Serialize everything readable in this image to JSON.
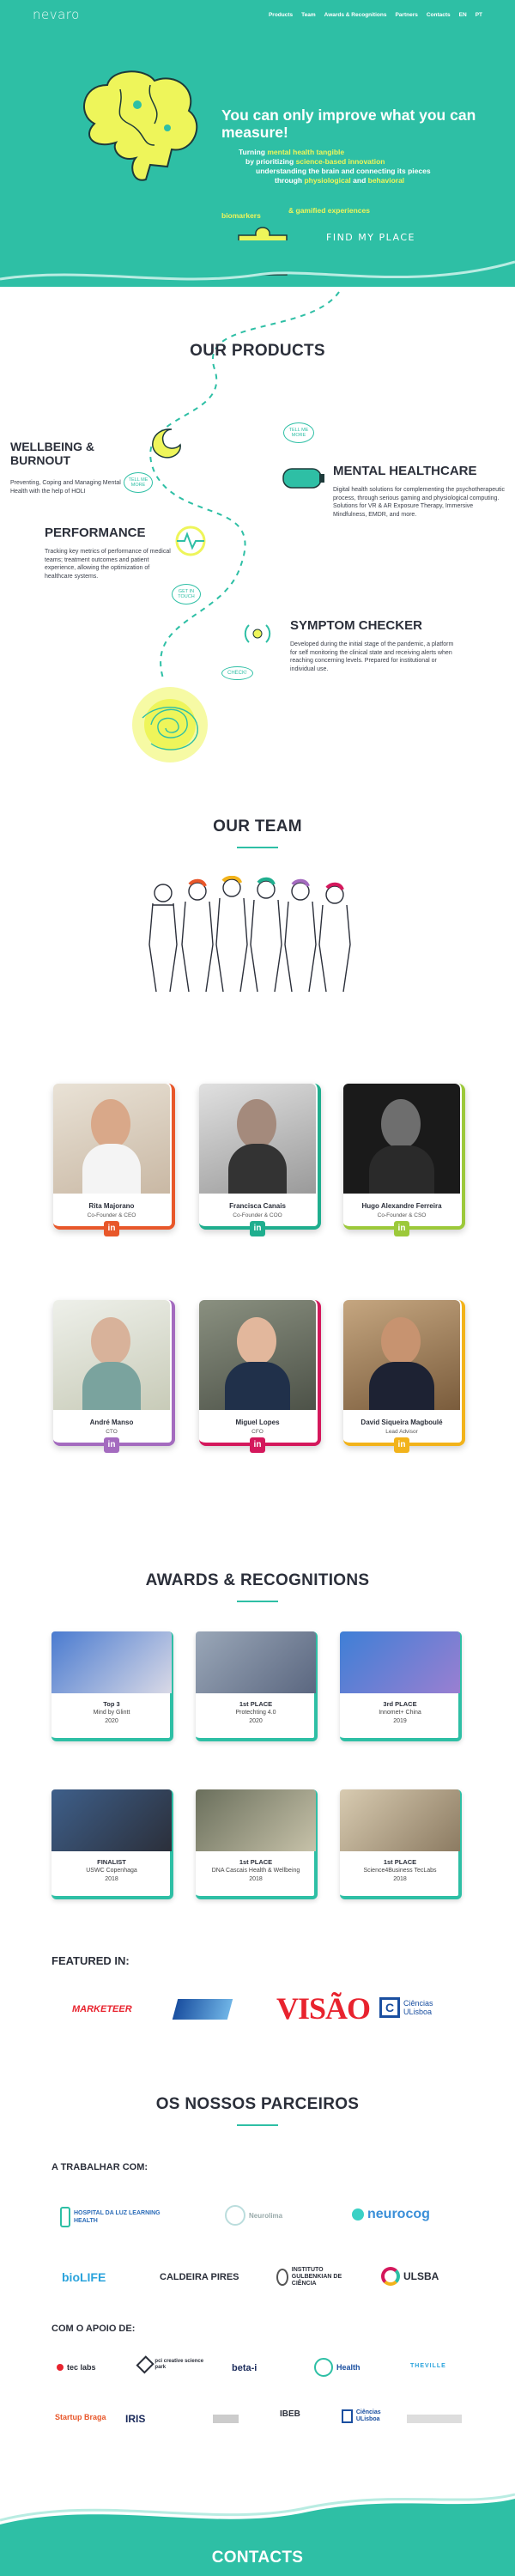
{
  "nav": {
    "logo": "nevaro",
    "links": [
      "Products",
      "Team",
      "Awards & Recognitions",
      "Partners",
      "Contacts",
      "EN",
      "PT"
    ]
  },
  "hero": {
    "title": "You can only improve what you can measure!",
    "line1_pre": "Turning ",
    "line1_hl": "mental health tangible",
    "line2_pre": "by prioritizing ",
    "line2_hl": "science-based innovation",
    "line3": "understanding the brain and connecting its pieces",
    "line4_pre": "through ",
    "line4_hl": "physiological",
    "line4_mid": " and ",
    "line4_hl2": "behavioral",
    "biomarkers": "biomarkers",
    "gamified": "& gamified experiences",
    "cta": "FIND MY PLACE"
  },
  "products": {
    "heading": "OUR PRODUCTS",
    "items": [
      {
        "title": "WELLBEING & BURNOUT",
        "desc": "Preventing, Coping and Managing Mental Health with the help of HOLI"
      },
      {
        "title": "MENTAL HEALTHCARE",
        "desc": "Digital health solutions for complementing the psychotherapeutic process, through serious gaming and physiological computing. Solutions for VR & AR Exposure Therapy, Immersive Mindfulness, EMDR, and more."
      },
      {
        "title": "PERFORMANCE",
        "desc": "Tracking key metrics of performance of medical teams; treatment outcomes and patient experience, allowing the optimization of healthcare systems."
      },
      {
        "title": "SYMPTOM CHECKER",
        "desc": "Developed during the initial stage of the pandemic, a platform for self monitoring the clinical state and receiving alerts when reaching concerning levels. Prepared for institutional or individual use."
      }
    ],
    "bubbles": [
      "TELL ME MORE",
      "TELL ME MORE",
      "GET IN TOUCH",
      "CHECK!"
    ]
  },
  "team": {
    "heading": "OUR TEAM",
    "members": [
      {
        "name": "Rita Majorano",
        "role": "Co-Founder & CEO"
      },
      {
        "name": "Francisca Canais",
        "role": "Co-Founder & COO"
      },
      {
        "name": "Hugo Alexandre Ferreira",
        "role": "Co-Founder & CSO"
      },
      {
        "name": "André Manso",
        "role": "CTO"
      },
      {
        "name": "Miguel Lopes",
        "role": "CFO"
      },
      {
        "name": "David Siqueira Magboulé",
        "role": "Lead Advisor"
      }
    ],
    "linkedin": "in"
  },
  "awards": {
    "heading": "AWARDS & RECOGNITIONS",
    "items": [
      {
        "place": "Top 3",
        "event": "Mind by Glintt",
        "year": "2020"
      },
      {
        "place": "1st PLACE",
        "event": "Protechting 4.0",
        "year": "2020"
      },
      {
        "place": "3rd PLACE",
        "event": "Innomet+ China",
        "year": "2019"
      },
      {
        "place": "FINALIST",
        "event": "USWC Copenhaga",
        "year": "2018"
      },
      {
        "place": "1st PLACE",
        "event": "DNA Cascais Health & Wellbeing",
        "year": "2018"
      },
      {
        "place": "1st PLACE",
        "event": "Science4Business TecLabs",
        "year": "2018"
      }
    ],
    "featured_heading": "FEATURED IN:",
    "featured": [
      "MARKETEER",
      "VISÃO",
      "Ciências ULisboa"
    ]
  },
  "partners": {
    "heading": "OS NOSSOS PARCEIROS",
    "working_with": "A TRABALHAR COM:",
    "working": [
      "HOSPITAL DA LUZ LEARNING HEALTH",
      "Neurolima",
      "neurocog",
      "bioLIFE",
      "CALDEIRA PIRES",
      "INSTITUTO GULBENKIAN DE CIÊNCIA",
      "ULSBA"
    ],
    "support_with": "COM O APOIO DE:",
    "support": [
      "tec labs",
      "pci creative science park",
      "beta-i",
      "Health",
      "THEVILLE",
      "Startup Braga",
      "IRIS",
      "",
      "IBEB",
      "Ciências ULisboa",
      ""
    ]
  },
  "contacts": {
    "heading": "CONTACTS"
  },
  "colors": {
    "teal": "#2ebfa5",
    "yellow": "#eef55a",
    "orange": "#e8572a",
    "green": "#1fae8e",
    "lime": "#9cc93a",
    "purple": "#a46bbf",
    "pink": "#d4185c",
    "gold": "#f2b31b"
  }
}
